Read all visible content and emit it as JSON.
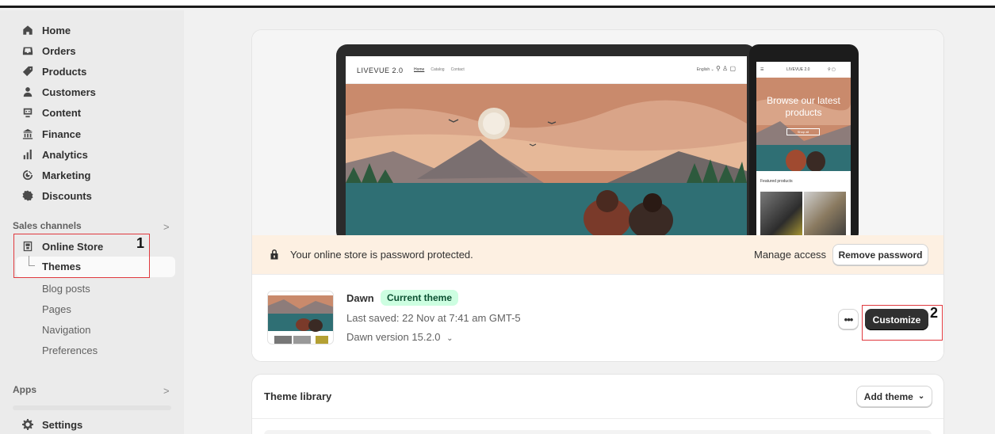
{
  "sidebar": {
    "nav": [
      {
        "label": "Home",
        "icon": "home-icon"
      },
      {
        "label": "Orders",
        "icon": "inbox-icon"
      },
      {
        "label": "Products",
        "icon": "tag-icon"
      },
      {
        "label": "Customers",
        "icon": "person-icon"
      },
      {
        "label": "Content",
        "icon": "content-icon"
      },
      {
        "label": "Finance",
        "icon": "bank-icon"
      },
      {
        "label": "Analytics",
        "icon": "bar-chart-icon"
      },
      {
        "label": "Marketing",
        "icon": "target-icon"
      },
      {
        "label": "Discounts",
        "icon": "discount-icon"
      }
    ],
    "sales_channels_label": "Sales channels",
    "online_store_label": "Online Store",
    "sub_items": [
      "Themes",
      "Blog posts",
      "Pages",
      "Navigation",
      "Preferences"
    ],
    "apps_label": "Apps",
    "settings_label": "Settings"
  },
  "annotations": {
    "one": "1",
    "two": "2"
  },
  "preview": {
    "laptop": {
      "logo": "LIVEVUE 2.0",
      "links": [
        "Home",
        "Catalog",
        "Contact"
      ],
      "language": "English ⌄"
    },
    "phone": {
      "logo": "LIVEVUE 2.0",
      "hero_text": "Browse our latest products",
      "hero_button": "Shop all",
      "featured": "Featured products"
    }
  },
  "password_bar": {
    "message": "Your online store is password protected.",
    "manage_label": "Manage access",
    "remove_label": "Remove password",
    "bg_color": "#fdf0e2"
  },
  "current_theme": {
    "name": "Dawn",
    "badge": "Current theme",
    "last_saved": "Last saved: 22 Nov at 7:41 am GMT-5",
    "version": "Dawn version 15.2.0",
    "more_label": "•••",
    "customize_label": "Customize"
  },
  "theme_library": {
    "title": "Theme library",
    "add_label": "Add theme"
  },
  "colors": {
    "accent_dark": "#303030",
    "badge_bg": "#cdfee1",
    "badge_text": "#0c5132",
    "annotation": "#e0393e"
  }
}
